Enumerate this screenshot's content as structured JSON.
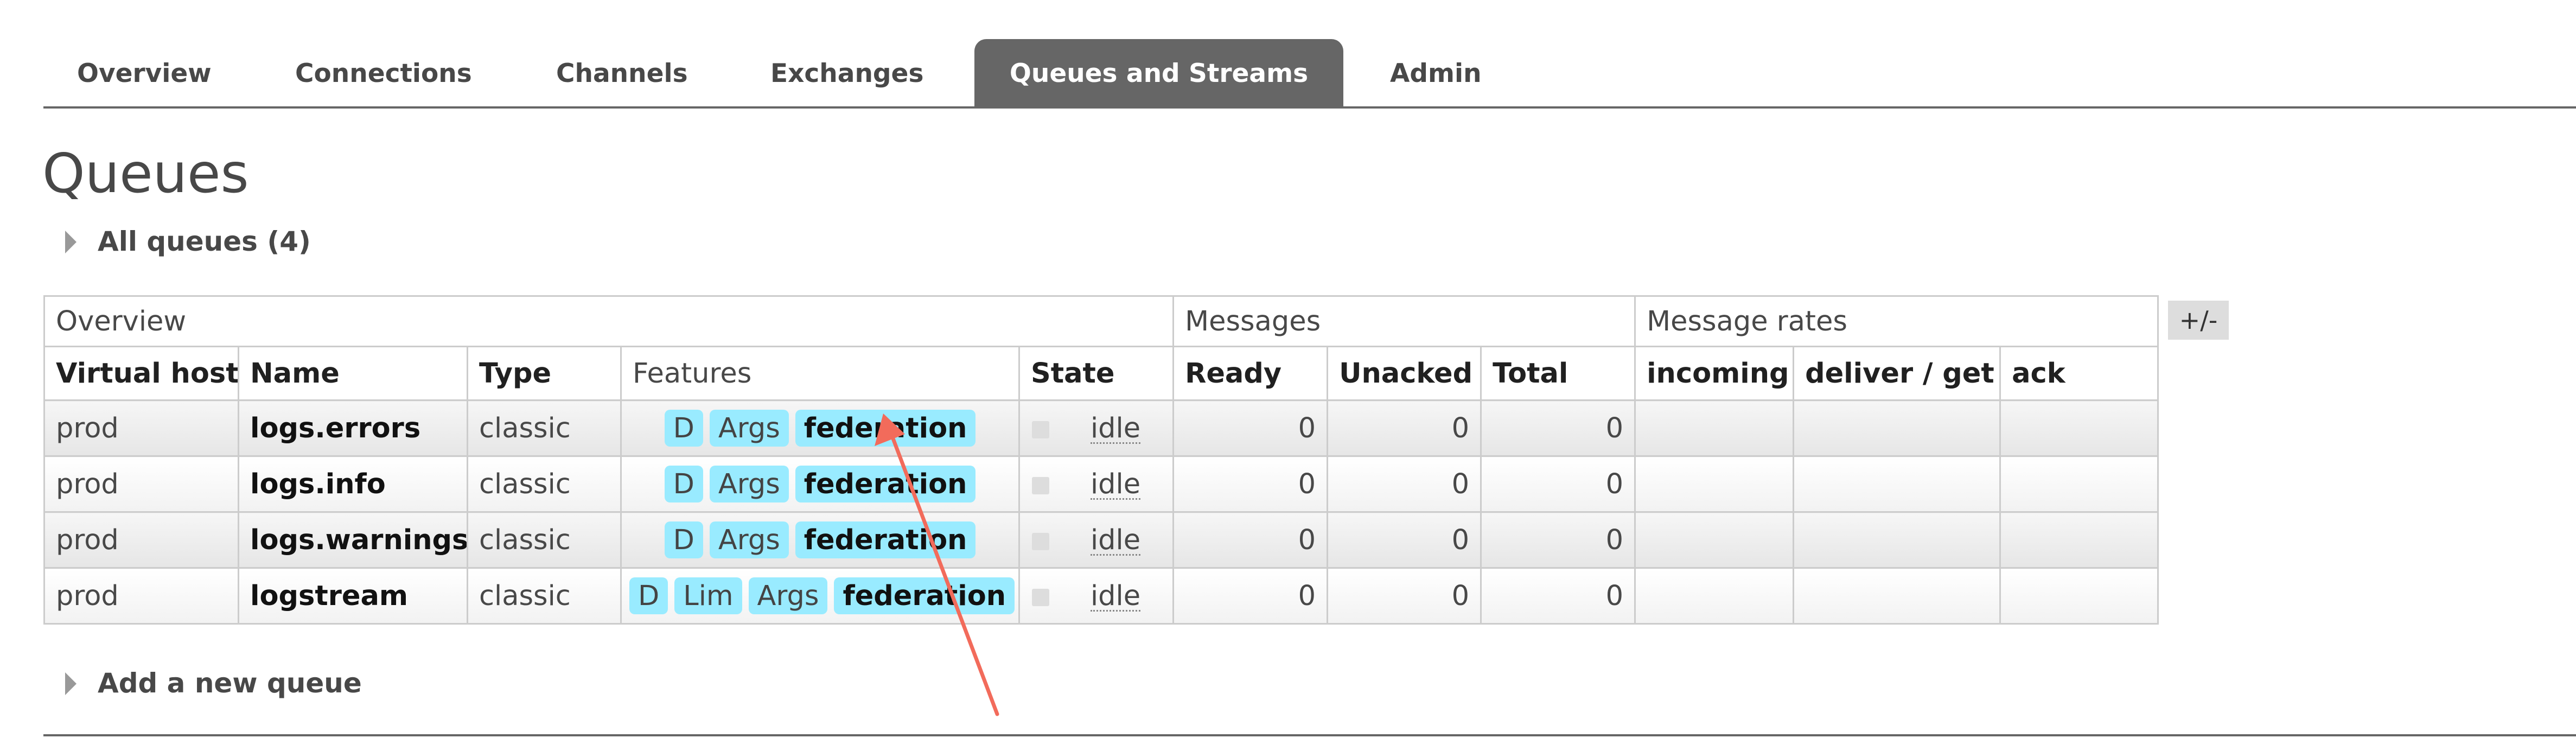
{
  "nav": {
    "tabs": [
      {
        "label": "Overview"
      },
      {
        "label": "Connections"
      },
      {
        "label": "Channels"
      },
      {
        "label": "Exchanges"
      },
      {
        "label": "Queues and Streams",
        "active": true
      },
      {
        "label": "Admin"
      }
    ]
  },
  "page": {
    "title": "Queues",
    "all_queues_toggle": "All queues (4)",
    "add_queue_toggle": "Add a new queue",
    "columns_toggle": "+/-"
  },
  "table": {
    "groups": {
      "overview": "Overview",
      "messages": "Messages",
      "rates": "Message rates"
    },
    "headers": {
      "vhost": "Virtual host",
      "name": "Name",
      "type": "Type",
      "features": "Features",
      "state": "State",
      "ready": "Ready",
      "unacked": "Unacked",
      "total": "Total",
      "incoming": "incoming",
      "deliver_get": "deliver / get",
      "ack": "ack"
    },
    "rows": [
      {
        "vhost": "prod",
        "name": "logs.errors",
        "type": "classic",
        "features": [
          "D",
          "Args",
          "federation"
        ],
        "state": "idle",
        "ready": "0",
        "unacked": "0",
        "total": "0"
      },
      {
        "vhost": "prod",
        "name": "logs.info",
        "type": "classic",
        "features": [
          "D",
          "Args",
          "federation"
        ],
        "state": "idle",
        "ready": "0",
        "unacked": "0",
        "total": "0"
      },
      {
        "vhost": "prod",
        "name": "logs.warnings",
        "type": "classic",
        "features": [
          "D",
          "Args",
          "federation"
        ],
        "state": "idle",
        "ready": "0",
        "unacked": "0",
        "total": "0"
      },
      {
        "vhost": "prod",
        "name": "logstream",
        "type": "classic",
        "features": [
          "D",
          "Lim",
          "Args",
          "federation"
        ],
        "state": "idle",
        "ready": "0",
        "unacked": "0",
        "total": "0"
      }
    ]
  },
  "colors": {
    "active_tab": "#666666",
    "badge": "#99ebff",
    "annotation_arrow": "#f26b5b"
  }
}
